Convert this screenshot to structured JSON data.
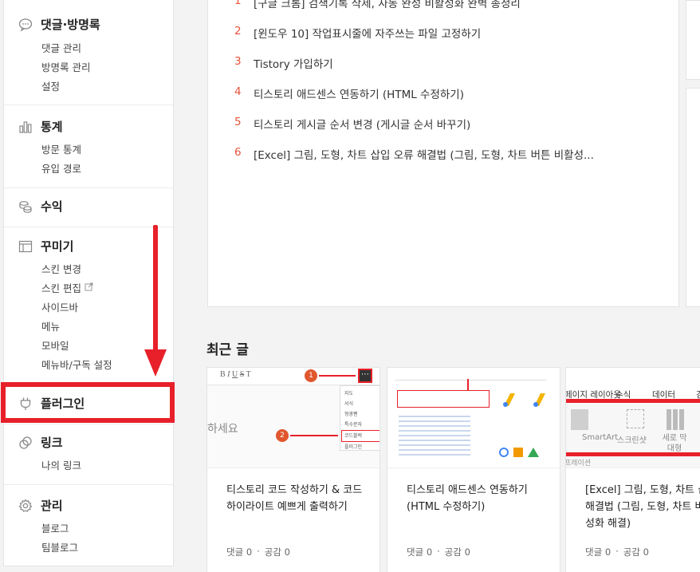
{
  "sidebar": {
    "comments": {
      "title": "댓글·방명록",
      "items": [
        "댓글 관리",
        "방명록 관리",
        "설정"
      ]
    },
    "stats": {
      "title": "통계",
      "items": [
        "방문 통계",
        "유입 경로"
      ]
    },
    "revenue": {
      "title": "수익"
    },
    "design": {
      "title": "꾸미기",
      "items": [
        "스킨 변경",
        "스킨 편집",
        "사이드바",
        "메뉴",
        "모바일",
        "메뉴바/구독 설정"
      ]
    },
    "plugin": {
      "title": "플러그인"
    },
    "links": {
      "title": "링크",
      "items": [
        "나의 링크"
      ]
    },
    "manage": {
      "title": "관리",
      "items": [
        "블로그",
        "팀블로그"
      ]
    }
  },
  "popular_posts": [
    {
      "num": "1",
      "title": "[구글 크롬] 검색기록 삭제, 자동 완성 비활성화 완벽 총정리"
    },
    {
      "num": "2",
      "title": "[윈도우 10] 작업표시줄에 자주쓰는 파일 고정하기"
    },
    {
      "num": "3",
      "title": "Tistory 가입하기"
    },
    {
      "num": "4",
      "title": "티스토리 애드센스 연동하기 (HTML 수정하기)"
    },
    {
      "num": "5",
      "title": "티스토리 게시글 순서 변경 (게시글 순서 바꾸기)"
    },
    {
      "num": "6",
      "title": "[Excel] 그림, 도형, 차트 삽입 오류 해결법 (그림, 도형, 차트 버튼 비활성..."
    }
  ],
  "recent": {
    "heading": "최근 글",
    "cards": [
      {
        "title": "티스토리 코드 작성하기 & 코드 하이라이트 예쁘게 출력하기",
        "comments": "댓글 0",
        "likes": "공감 0"
      },
      {
        "title": "티스토리 애드센스 연동하기 (HTML 수정하기)",
        "comments": "댓글 0",
        "likes": "공감 0"
      },
      {
        "title": "[Excel] 그림, 도형, 차트 삽입 오류 해결법 (그림, 도형, 차트 버튼 비활성화 해결)",
        "comments": "댓글 0",
        "likes": "공감 0"
      }
    ]
  },
  "thumb1": {
    "placeholder": "하세요",
    "menu": [
      "지도",
      "서식",
      "형광펜",
      "특수문자",
      "코드블럭",
      "플러그인"
    ],
    "badge1": "1",
    "badge2": "2"
  },
  "thumb3": {
    "tabs": [
      "페이지 레이아웃",
      "수식",
      "데이터",
      "검"
    ],
    "ribbon": [
      "SmartArt",
      "스크린샷",
      "세로 막대형"
    ],
    "footer": "프레이션"
  },
  "colors": {
    "accent": "#e8202a",
    "number": "#e8533b"
  }
}
